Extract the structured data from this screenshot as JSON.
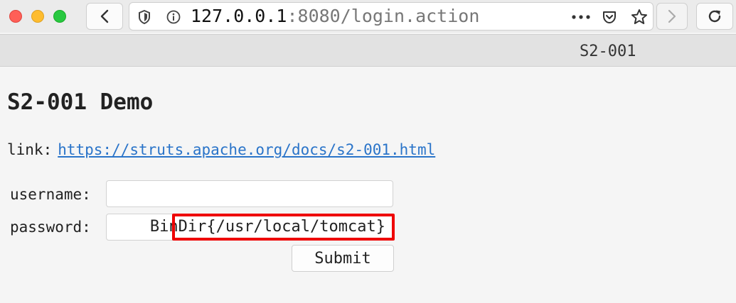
{
  "browser": {
    "url_host": "127.0.0.1",
    "url_rest": ":8080/login.action",
    "tab_title": "S2-001",
    "icons": [
      "back-icon",
      "forward-icon",
      "reload-icon",
      "shield-icon",
      "info-icon",
      "more-icon",
      "pocket-icon",
      "bookmark-star-icon"
    ]
  },
  "page": {
    "title": "S2-001 Demo",
    "link_label": "link:",
    "link_text": "https://struts.apache.org/docs/s2-001.html"
  },
  "form": {
    "username_label": "username:",
    "username_value": "",
    "password_label": "password:",
    "password_value": "BinDir{/usr/local/tomcat}",
    "submit_label": "Submit"
  },
  "colors": {
    "highlight": "#ee0000",
    "link": "#2a74c9"
  }
}
